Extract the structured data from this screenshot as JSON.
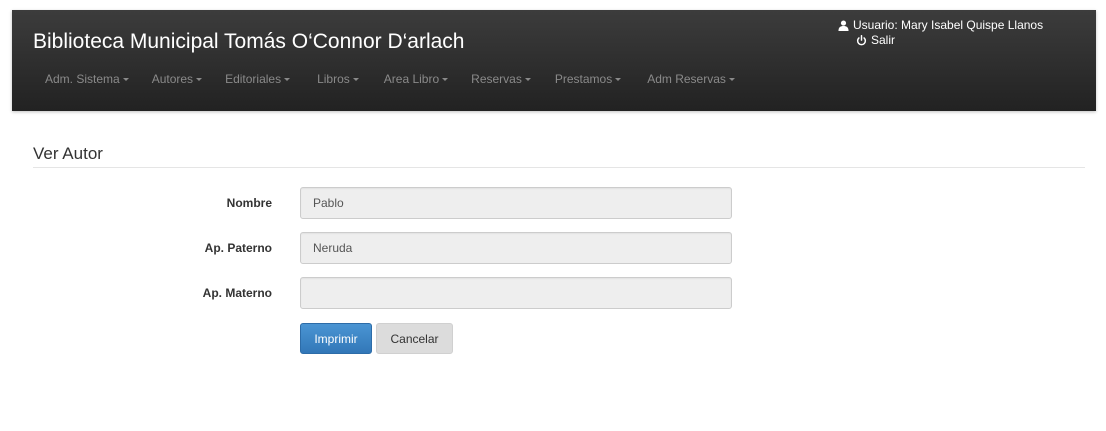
{
  "header": {
    "brand": "Biblioteca Municipal Tomás O‘Connor D‘arlach",
    "user_label": "Usuario: Mary Isabel Quispe Llanos",
    "logout_label": "Salir",
    "bg_color": "#222222"
  },
  "nav": {
    "items": [
      {
        "label": "Adm. Sistema"
      },
      {
        "label": "Autores"
      },
      {
        "label": "Editoriales"
      },
      {
        "label": "Libros"
      },
      {
        "label": "Area Libro"
      },
      {
        "label": "Reservas"
      },
      {
        "label": "Prestamos"
      },
      {
        "label": "Adm Reservas"
      }
    ]
  },
  "page": {
    "title": "Ver Autor"
  },
  "form": {
    "nombre_label": "Nombre",
    "nombre_value": "Pablo",
    "paterno_label": "Ap. Paterno",
    "paterno_value": "Neruda",
    "materno_label": "Ap. Materno",
    "materno_value": ""
  },
  "actions": {
    "print_label": "Imprimir",
    "cancel_label": "Cancelar",
    "primary_color": "#3a86c8"
  }
}
